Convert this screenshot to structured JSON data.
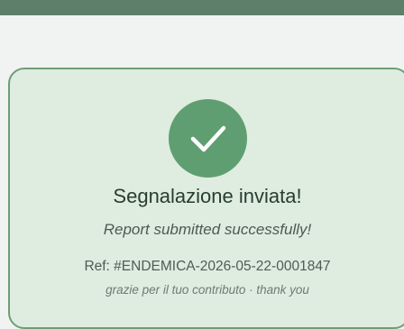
{
  "confirmation": {
    "icon": "check-icon",
    "title": "Segnalazione inviata!",
    "subtitle": "Report submitted successfully!",
    "reference": "Ref: #ENDEMICA-2026-05-22-0001847",
    "thanks": "grazie per il tuo contributo · thank you"
  },
  "colors": {
    "topbar": "#5e7f69",
    "card_bg": "#dfece0",
    "card_border": "#6c9e76",
    "success_green": "#5f9e70",
    "title_text": "#283e2e"
  }
}
